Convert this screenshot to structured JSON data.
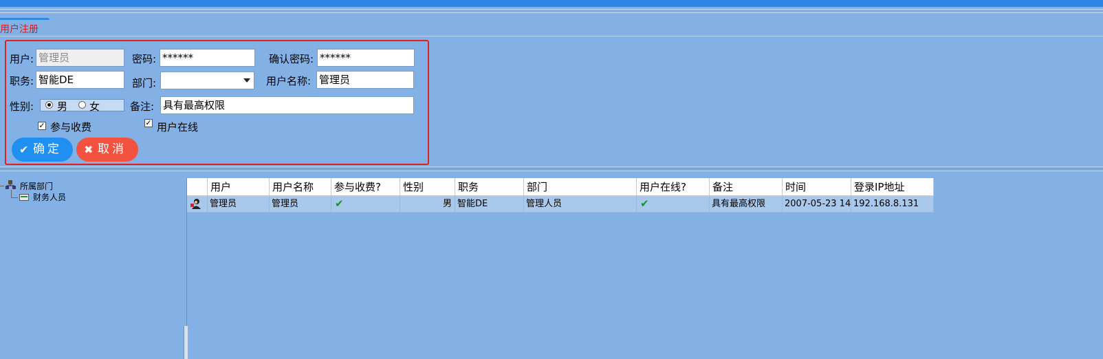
{
  "window": {
    "tab_title": "用户注册"
  },
  "form": {
    "user_label": "用户:",
    "user_value": "管理员",
    "password_label": "密码:",
    "password_value": "******",
    "confirm_label": "确认密码:",
    "confirm_value": "******",
    "duty_label": "职务:",
    "duty_value": "智能DE",
    "dept_label": "部门:",
    "dept_value": "",
    "username_label": "用户名称:",
    "username_value": "管理员",
    "gender_label": "性别:",
    "gender_male": "男",
    "gender_female": "女",
    "gender_selected": "男",
    "remark_label": "备注:",
    "remark_value": "具有最高权限",
    "charge_label": "参与收费",
    "charge_checked": true,
    "online_label": "用户在线",
    "online_checked": true,
    "ok_icon": "✔",
    "ok_label": "确定",
    "cancel_icon": "✖",
    "cancel_label": "取消"
  },
  "tree": {
    "root_label": "所属部门",
    "root_icon": "dept-tree-icon",
    "child_label": "财务人员",
    "child_icon": "card-icon"
  },
  "table": {
    "columns": [
      "",
      "用户",
      "用户名称",
      "参与收费?",
      "性别",
      "职务",
      "部门",
      "用户在线?",
      "备注",
      "时间",
      "登录IP地址"
    ],
    "rows": [
      {
        "icon": "user-icon",
        "user": "管理员",
        "username": "管理员",
        "charge": "✔",
        "gender": "男",
        "duty": "智能DE",
        "dept": "管理人员",
        "online": "✔",
        "remark": "具有最高权限",
        "time": "2007-05-23 14",
        "ip": "192.168.8.131"
      }
    ]
  },
  "colors": {
    "background": "#83b1e6",
    "accent": "#2d86e8",
    "ok_button": "#1f8ff2",
    "cancel_button": "#f2523f",
    "highlight_border": "#e2201b"
  }
}
